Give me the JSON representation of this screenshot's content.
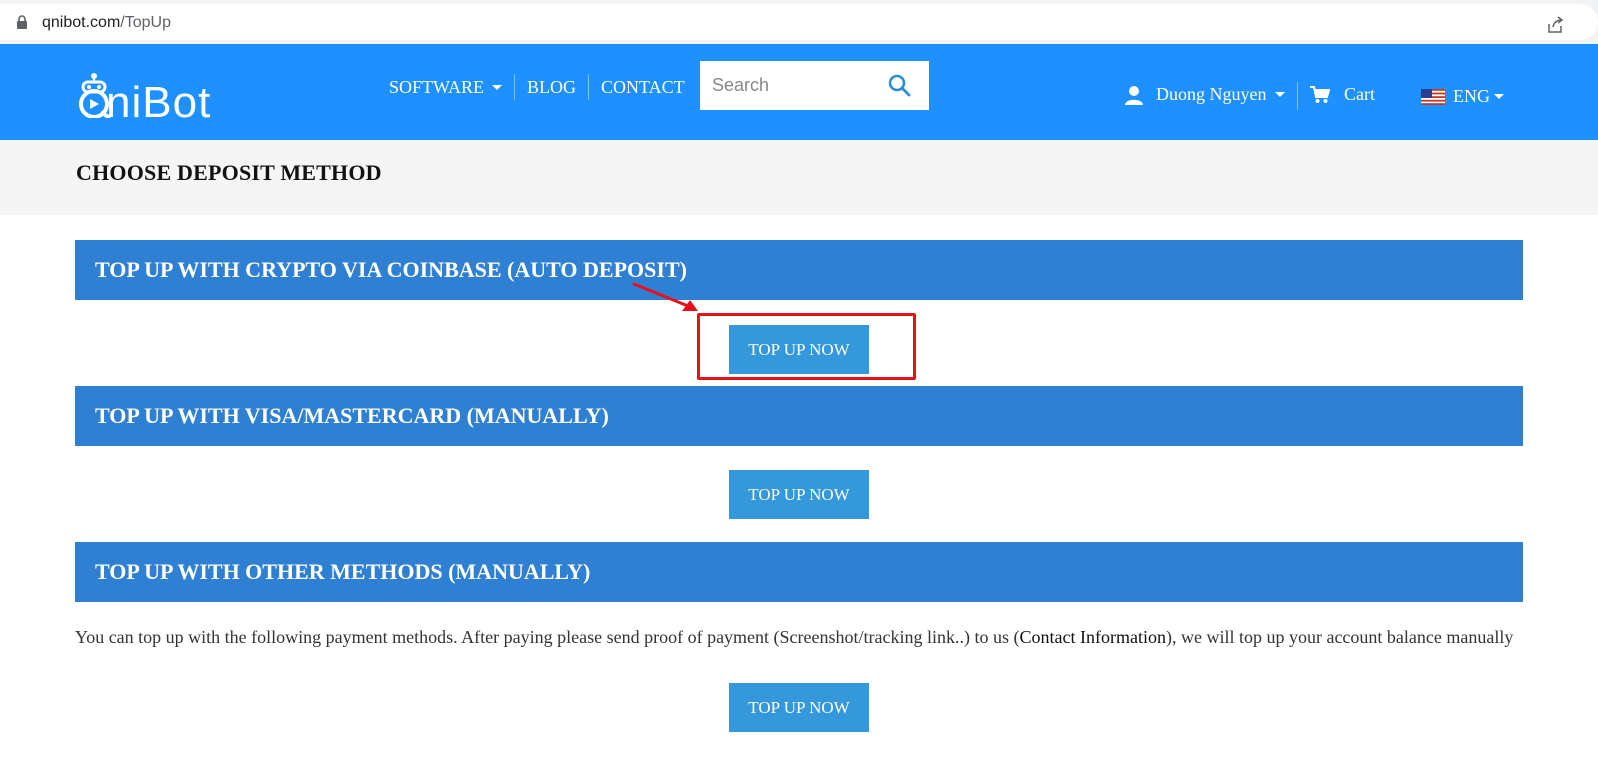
{
  "browser": {
    "url_domain": "qnibot.com",
    "url_path": "/TopUp"
  },
  "header": {
    "logo_text": "niBot",
    "nav": [
      {
        "label": "SOFTWARE"
      },
      {
        "label": "BLOG"
      },
      {
        "label": "CONTACT"
      }
    ],
    "search_placeholder": "Search",
    "user_name": "Duong Nguyen",
    "cart_label": "Cart",
    "language": "ENG"
  },
  "page": {
    "title": "CHOOSE DEPOSIT METHOD"
  },
  "sections": [
    {
      "title": "TOP UP WITH CRYPTO VIA COINBASE (AUTO DEPOSIT)",
      "button": "TOP UP NOW"
    },
    {
      "title": "TOP UP WITH VISA/MASTERCARD (MANUALLY)",
      "button": "TOP UP NOW"
    },
    {
      "title": "TOP UP WITH OTHER METHODS (MANUALLY)",
      "button": "TOP UP NOW"
    }
  ],
  "other_methods": {
    "text_before": "You can top up with the following payment methods. After paying please send proof of payment (Screenshot/tracking link..) to us (",
    "link": "Contact Information",
    "text_after": "), we will top up your account balance manually"
  },
  "colors": {
    "header_bg": "#1e90ff",
    "section_header_bg": "#2f80d2",
    "button_bg": "#3498db",
    "annotation": "#e8111b"
  }
}
